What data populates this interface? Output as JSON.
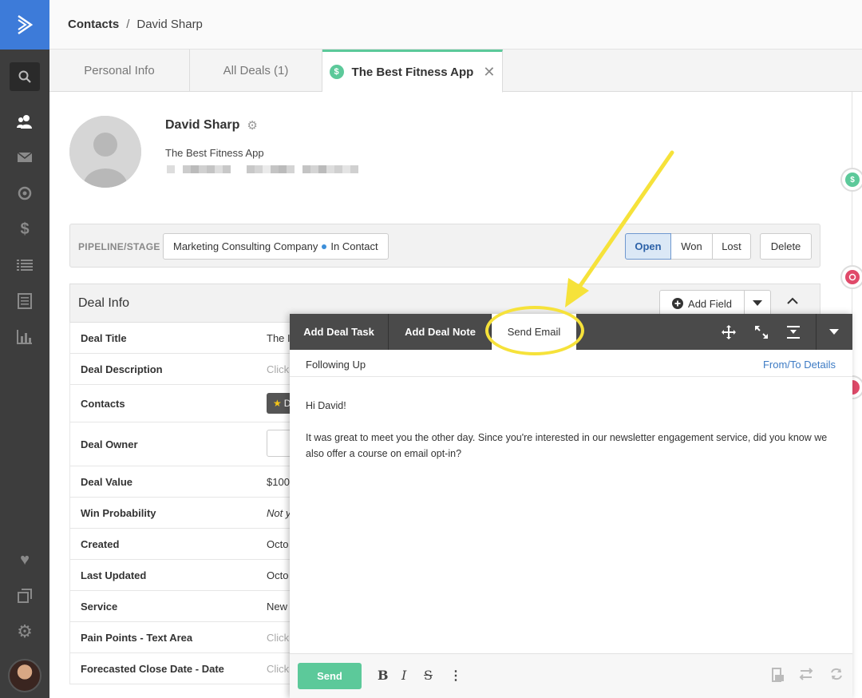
{
  "breadcrumb": {
    "root": "Contacts",
    "separator": "/",
    "current": "David Sharp"
  },
  "tabs": [
    {
      "label": "Personal Info"
    },
    {
      "label": "All Deals (1)"
    },
    {
      "label": "The Best Fitness App",
      "icon": "$",
      "close": "✕"
    }
  ],
  "profile": {
    "name": "David Sharp",
    "company": "The Best Fitness App"
  },
  "pipeline": {
    "label": "PIPELINE/STAGE",
    "pipeline_name": "Marketing Consulting Company",
    "stage": "In Contact",
    "status_buttons": [
      "Open",
      "Won",
      "Lost"
    ],
    "active_status": "Open",
    "delete_label": "Delete"
  },
  "deal_info": {
    "title": "Deal Info",
    "add_field_label": "Add Field",
    "rows": [
      {
        "label": "Deal Title",
        "value": "The I"
      },
      {
        "label": "Deal Description",
        "value": "Click"
      },
      {
        "label": "Contacts",
        "value": "D"
      },
      {
        "label": "Deal Owner",
        "value": ""
      },
      {
        "label": "Deal Value",
        "value": "$100"
      },
      {
        "label": "Win Probability",
        "value": "Not y"
      },
      {
        "label": "Created",
        "value": "Octo"
      },
      {
        "label": "Last Updated",
        "value": "Octo"
      },
      {
        "label": "Service",
        "value": "New"
      },
      {
        "label": "Pain Points - Text Area",
        "value": "Click"
      },
      {
        "label": "Forecasted Close Date - Date",
        "value": "Click"
      }
    ]
  },
  "composer": {
    "tabs": [
      "Add Deal Task",
      "Add Deal Note",
      "Send Email"
    ],
    "active_tab": "Send Email",
    "subject": "Following Up",
    "from_to_link": "From/To Details",
    "body": [
      "Hi David!",
      "It was great to meet you the other day. Since you're interested in our newsletter engagement service, did you know we also offer a course on email opt-in?"
    ],
    "send_label": "Send",
    "format_bold": "B",
    "format_italic": "I",
    "format_strike": "S",
    "format_more": "⋮"
  },
  "rail": {
    "deal_icon": "$"
  },
  "colors": {
    "accent_green": "#5cc99a",
    "brand_blue": "#3d7bd9",
    "highlight_yellow": "#f6e23a",
    "dark_sidebar": "#3d3d3d"
  }
}
